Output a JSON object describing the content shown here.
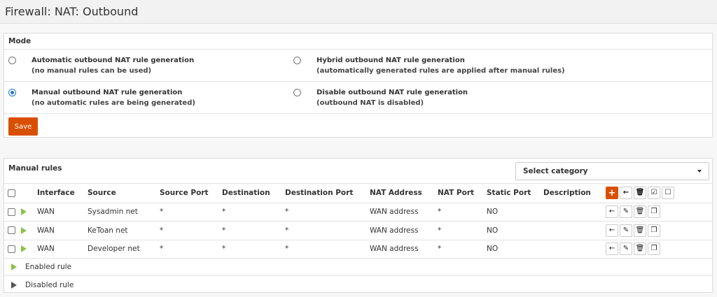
{
  "page": {
    "title": "Firewall: NAT: Outbound"
  },
  "mode": {
    "heading": "Mode",
    "options": [
      {
        "title": "Automatic outbound NAT rule generation",
        "subtitle": "(no manual rules can be used)",
        "checked": false
      },
      {
        "title": "Hybrid outbound NAT rule generation",
        "subtitle": "(automatically generated rules are applied after manual rules)",
        "checked": false
      },
      {
        "title": "Manual outbound NAT rule generation",
        "subtitle": "(no automatic rules are being generated)",
        "checked": true
      },
      {
        "title": "Disable outbound NAT rule generation",
        "subtitle": "(outbound NAT is disabled)",
        "checked": false
      }
    ],
    "save_label": "Save"
  },
  "rules": {
    "heading": "Manual rules",
    "category_placeholder": "Select category",
    "columns": [
      "Interface",
      "Source",
      "Source Port",
      "Destination",
      "Destination Port",
      "NAT Address",
      "NAT Port",
      "Static Port",
      "Description"
    ],
    "rows": [
      {
        "interface": "WAN",
        "source": "Sysadmin net",
        "source_port": "*",
        "destination": "*",
        "destination_port": "*",
        "nat_address": "WAN address",
        "nat_port": "*",
        "static_port": "NO",
        "description": ""
      },
      {
        "interface": "WAN",
        "source": "KeToan net",
        "source_port": "*",
        "destination": "*",
        "destination_port": "*",
        "nat_address": "WAN address",
        "nat_port": "*",
        "static_port": "NO",
        "description": ""
      },
      {
        "interface": "WAN",
        "source": "Developer net",
        "source_port": "*",
        "destination": "*",
        "destination_port": "*",
        "nat_address": "WAN address",
        "nat_port": "*",
        "static_port": "NO",
        "description": ""
      }
    ],
    "legend": {
      "enabled": "Enabled rule",
      "disabled": "Disabled rule"
    }
  },
  "icons": {
    "add": "plus-icon",
    "move": "arrow-left-icon",
    "edit": "pencil-icon",
    "delete": "trash-icon",
    "copy": "copy-icon",
    "enable": "check-square-icon",
    "disable": "square-icon",
    "enabled_status": "play-icon"
  },
  "colors": {
    "accent": "#d94f00",
    "enabled": "#8bc34a",
    "radio": "#2575d6"
  }
}
